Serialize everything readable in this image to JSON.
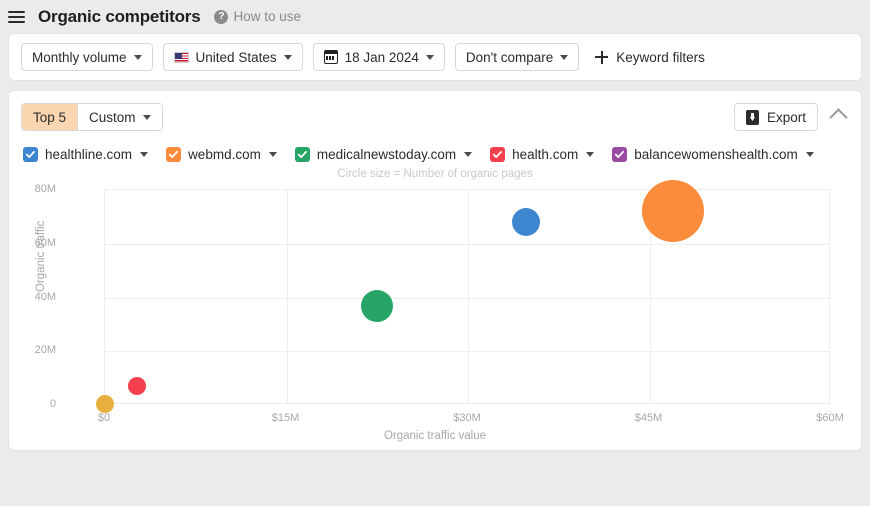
{
  "header": {
    "menu_icon": "hamburger-icon",
    "title": "Organic competitors",
    "help_icon": "question-mark-icon",
    "help_label": "How to use"
  },
  "filters": {
    "metric": {
      "label": "Monthly volume",
      "icon": "chevron-down-icon"
    },
    "country": {
      "label": "United States",
      "icon": "us-flag-icon"
    },
    "date": {
      "label": "18 Jan 2024",
      "icon": "calendar-icon"
    },
    "compare": {
      "label": "Don't compare",
      "icon": "chevron-down-icon"
    },
    "keyword_filters": {
      "label": "Keyword filters",
      "icon": "plus-icon"
    }
  },
  "panel": {
    "segments": [
      {
        "label": "Top 5",
        "active": true
      },
      {
        "label": "Custom",
        "active": false
      }
    ],
    "export_label": "Export",
    "export_icon": "download-icon",
    "collapse_icon": "chevron-up-icon"
  },
  "legend": [
    {
      "label": "healthline.com",
      "color": "#3f86d1",
      "checked": true
    },
    {
      "label": "webmd.com",
      "color": "#fb8c3c",
      "checked": true
    },
    {
      "label": "medicalnewstoday.com",
      "color": "#27a567",
      "checked": true
    },
    {
      "label": "health.com",
      "color": "#f5404f",
      "checked": true
    },
    {
      "label": "balancewomenshealth.com",
      "color": "#9c4ba3",
      "checked": true
    }
  ],
  "chart_data": {
    "type": "scatter",
    "title": "",
    "subtitle": "Circle size = Number of organic pages",
    "xlabel": "Organic traffic value",
    "ylabel": "Organic traffic",
    "xlim": [
      0,
      60000000
    ],
    "ylim": [
      0,
      80000000
    ],
    "xticks": [
      "$0",
      "$15M",
      "$30M",
      "$45M",
      "$60M"
    ],
    "xtick_values": [
      0,
      15000000,
      30000000,
      45000000,
      60000000
    ],
    "yticks": [
      "0",
      "20M",
      "40M",
      "60M",
      "80M"
    ],
    "ytick_values": [
      0,
      20000000,
      40000000,
      60000000,
      80000000
    ],
    "grid": true,
    "legend_position": "top",
    "size_encoding": "Number of organic pages",
    "points": [
      {
        "name": "webmd.com",
        "x": 47000000,
        "y": 72000000,
        "r": 31,
        "color": "#fb8c3c"
      },
      {
        "name": "healthline.com",
        "x": 34900000,
        "y": 67700000,
        "r": 14,
        "color": "#3f86d1"
      },
      {
        "name": "medicalnewstoday.com",
        "x": 22600000,
        "y": 36500000,
        "r": 16,
        "color": "#27a567"
      },
      {
        "name": "health.com",
        "x": 2700000,
        "y": 6700000,
        "r": 9,
        "color": "#f5404f"
      },
      {
        "name": "balancewomenshealth.com",
        "x": 100000,
        "y": 0,
        "r": 9,
        "color": "#e8b03f"
      }
    ]
  }
}
